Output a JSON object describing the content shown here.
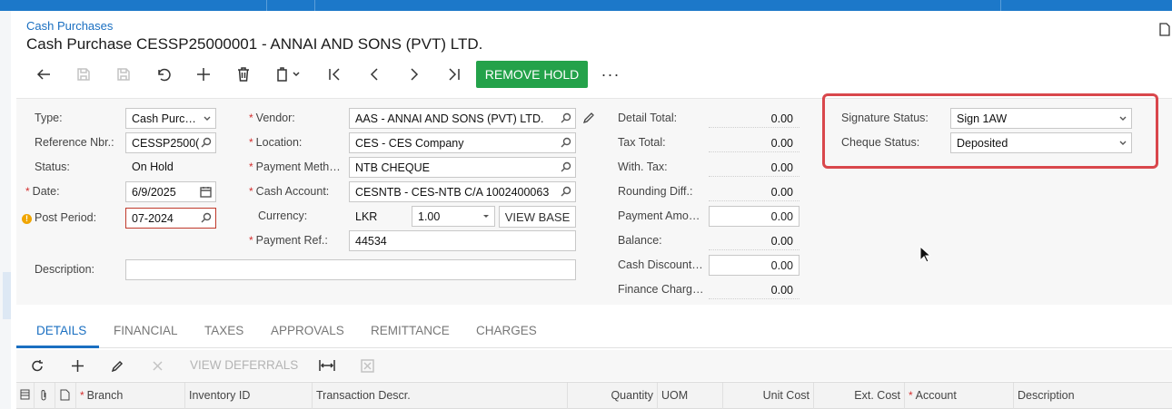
{
  "breadcrumb": "Cash Purchases",
  "page_title": "Cash Purchase CESSP25000001 - ANNAI AND SONS (PVT) LTD.",
  "toolbar": {
    "remove_hold_label": "REMOVE HOLD",
    "more_label": "···"
  },
  "form": {
    "type": {
      "label": "Type:",
      "value": "Cash Purc…"
    },
    "reference_nbr": {
      "label": "Reference Nbr.:",
      "value": "CESSP2500("
    },
    "status": {
      "label": "Status:",
      "value": "On Hold"
    },
    "date": {
      "label": "Date:",
      "value": "6/9/2025"
    },
    "post_period": {
      "label": "Post Period:",
      "value": "07-2024"
    },
    "description": {
      "label": "Description:",
      "value": ""
    },
    "vendor": {
      "label": "Vendor:",
      "value": "AAS - ANNAI AND SONS (PVT) LTD."
    },
    "location": {
      "label": "Location:",
      "value": "CES - CES Company"
    },
    "payment_method": {
      "label": "Payment Meth…",
      "value": "NTB CHEQUE"
    },
    "cash_account": {
      "label": "Cash Account:",
      "value": "CESNTB - CES-NTB C/A 1002400063"
    },
    "currency": {
      "label": "Currency:",
      "value": "LKR",
      "rate": "1.00",
      "view_base_label": "VIEW BASE"
    },
    "payment_ref": {
      "label": "Payment Ref.:",
      "value": "44534"
    }
  },
  "totals": {
    "detail_total": {
      "label": "Detail Total:",
      "value": "0.00"
    },
    "tax_total": {
      "label": "Tax Total:",
      "value": "0.00"
    },
    "with_tax": {
      "label": "With. Tax:",
      "value": "0.00"
    },
    "rounding_diff": {
      "label": "Rounding Diff.:",
      "value": "0.00"
    },
    "payment_amount": {
      "label": "Payment Amo…",
      "value": "0.00"
    },
    "balance": {
      "label": "Balance:",
      "value": "0.00"
    },
    "cash_discount": {
      "label": "Cash Discount…",
      "value": "0.00"
    },
    "finance_charges": {
      "label": "Finance Charg…",
      "value": "0.00"
    }
  },
  "status_panel": {
    "signature_status": {
      "label": "Signature Status:",
      "value": "Sign 1AW"
    },
    "cheque_status": {
      "label": "Cheque Status:",
      "value": "Deposited"
    }
  },
  "tabs": [
    "DETAILS",
    "FINANCIAL",
    "TAXES",
    "APPROVALS",
    "REMITTANCE",
    "CHARGES"
  ],
  "grid_toolbar": {
    "view_deferrals_label": "VIEW DEFERRALS"
  },
  "grid_columns": [
    "Branch",
    "Inventory ID",
    "Transaction Descr.",
    "Quantity",
    "UOM",
    "Unit Cost",
    "Ext. Cost",
    "Account",
    "Description"
  ],
  "colors": {
    "accent": "#1a6fc1",
    "success": "#24a24a",
    "highlight": "#d9474c",
    "topbar": "#1c78c9"
  }
}
